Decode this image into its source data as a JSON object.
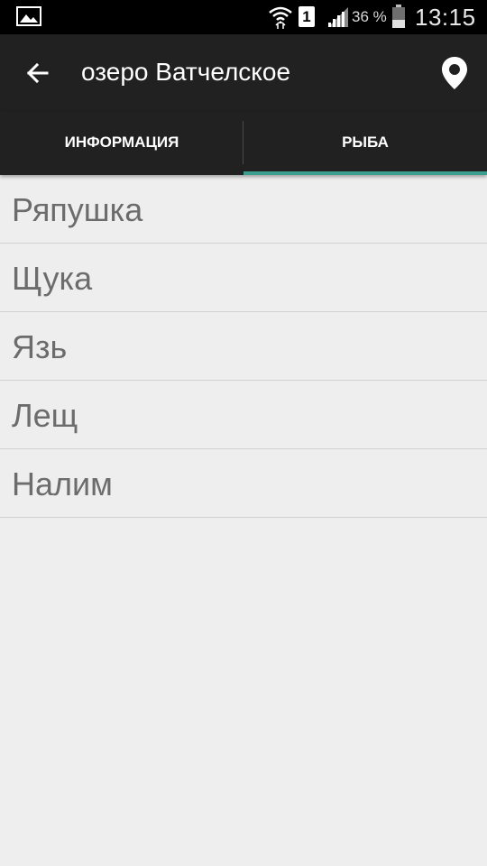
{
  "status_bar": {
    "sim_slot": "1",
    "battery_percent": "36 %",
    "time": "13:15",
    "icons": [
      "image-icon",
      "wifi-icon",
      "sim-icon",
      "signal-icon",
      "battery-icon"
    ]
  },
  "toolbar": {
    "title": "озеро Ватчелское",
    "back_icon": "arrow-left-icon",
    "action_icon": "location-pin-icon"
  },
  "tabs": [
    {
      "label": "ИНФОРМАЦИЯ",
      "selected": false
    },
    {
      "label": "РЫБА",
      "selected": true
    }
  ],
  "colors": {
    "app_bar": "#212121",
    "tab_indicator": "#3a9e90",
    "background": "#eeeeee",
    "list_text": "#6c6c6c"
  },
  "fish_list": [
    {
      "name": "Ряпушка"
    },
    {
      "name": "Щука"
    },
    {
      "name": "Язь"
    },
    {
      "name": "Лещ"
    },
    {
      "name": "Налим"
    }
  ]
}
